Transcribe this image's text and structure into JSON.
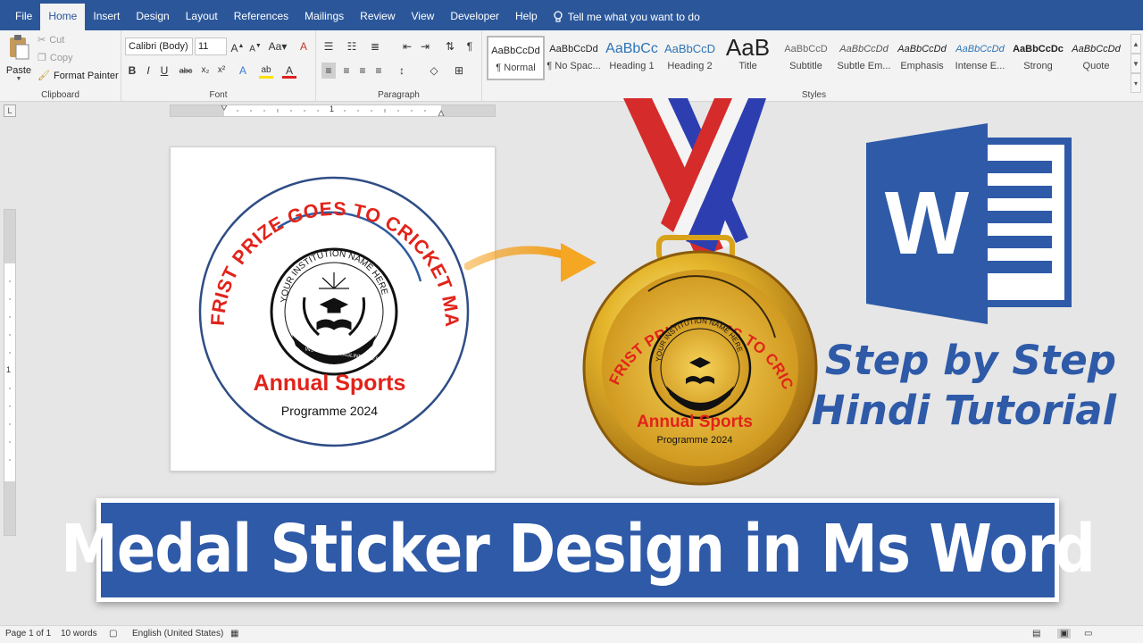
{
  "menu": {
    "tabs": [
      "File",
      "Home",
      "Insert",
      "Design",
      "Layout",
      "References",
      "Mailings",
      "Review",
      "View",
      "Developer",
      "Help"
    ],
    "active_tab": "Home",
    "tell_me": "Tell me what you want to do"
  },
  "clipboard": {
    "paste": "Paste",
    "cut": "Cut",
    "copy": "Copy",
    "format_painter": "Format Painter",
    "label": "Clipboard"
  },
  "font": {
    "name": "Calibri (Body)",
    "size": "11",
    "label": "Font"
  },
  "paragraph": {
    "label": "Paragraph"
  },
  "styles": {
    "label": "Styles",
    "items": [
      {
        "sample": "AaBbCcDd",
        "name": "¶ Normal"
      },
      {
        "sample": "AaBbCcDd",
        "name": "¶ No Spac..."
      },
      {
        "sample": "AaBbCc",
        "name": "Heading 1"
      },
      {
        "sample": "AaBbCcD",
        "name": "Heading 2"
      },
      {
        "sample": "AaB",
        "name": "Title"
      },
      {
        "sample": "AaBbCcD",
        "name": "Subtitle"
      },
      {
        "sample": "AaBbCcDd",
        "name": "Subtle Em..."
      },
      {
        "sample": "AaBbCcDd",
        "name": "Emphasis"
      },
      {
        "sample": "AaBbCcDd",
        "name": "Intense E..."
      },
      {
        "sample": "AaBbCcDc",
        "name": "Strong"
      },
      {
        "sample": "AaBbCcDd",
        "name": "Quote"
      }
    ]
  },
  "ruler": {
    "mark": "1"
  },
  "sticker": {
    "arc_text": "FRIST PRIZE GOES TO CRICKET MATCH",
    "institution": "YOUR INSTITUTION NAME HERE",
    "tagline": "INSTITUTION TAGLINE GOES HERE",
    "event": "Annual Sports",
    "programme": "Programme 2024"
  },
  "logo_letter": "W",
  "tutorial": {
    "line1": "Step by Step",
    "line2": "Hindi Tutorial"
  },
  "banner": {
    "title": "Medal Sticker Design in Ms Word"
  },
  "status": {
    "page": "Page 1 of 1",
    "words": "10 words",
    "language": "English (United States)"
  },
  "colors": {
    "word_blue": "#2b579a",
    "banner_blue": "#2e5aa8",
    "arc_red": "#e2231a",
    "medal_gold": "#d9a21b",
    "ribbon_red": "#e02b2b",
    "ribbon_blue": "#2d3fb0"
  },
  "icons": [
    "paste-icon",
    "cut-icon",
    "copy-icon",
    "format-painter-icon",
    "bold-icon",
    "italic-icon",
    "underline-icon",
    "bullets-icon",
    "numbering-icon",
    "align-left-icon",
    "pilcrow-icon",
    "lightbulb-icon",
    "word-logo-icon",
    "arrow-icon",
    "medal-icon"
  ]
}
